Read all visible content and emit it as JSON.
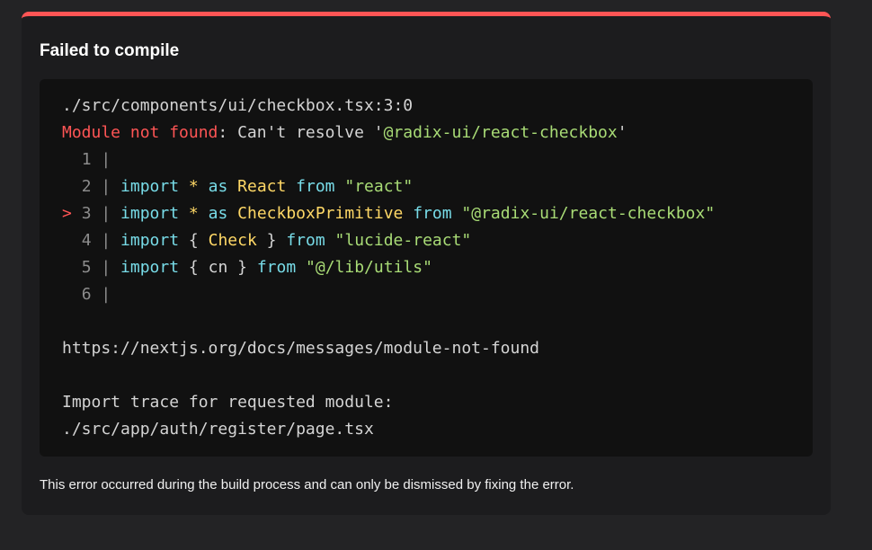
{
  "dialog": {
    "title": "Failed to compile",
    "footer": "This error occurred during the build process and can only be dismissed by fixing the error."
  },
  "error": {
    "location": "./src/components/ui/checkbox.tsx:3:0",
    "kind": "Module not found",
    "message_prefix": ": Can't resolve '",
    "module": "@radix-ui/react-checkbox",
    "message_suffix": "'",
    "doc_link": "https://nextjs.org/docs/messages/module-not-found",
    "trace_heading": "Import trace for requested module:",
    "trace_file": "./src/app/auth/register/page.tsx"
  },
  "code": {
    "highlighted_line": 3,
    "lines": [
      {
        "num": "1",
        "marker": " "
      },
      {
        "num": "2",
        "marker": " ",
        "kw_import": "import",
        "star": "*",
        "kw_as": "as",
        "name": "React",
        "kw_from": "from",
        "source": "\"react\""
      },
      {
        "num": "3",
        "marker": ">",
        "kw_import": "import",
        "star": "*",
        "kw_as": "as",
        "name": "CheckboxPrimitive",
        "kw_from": "from",
        "source": "\"@radix-ui/react-checkbox\""
      },
      {
        "num": "4",
        "marker": " ",
        "kw_import": "import",
        "open": "{",
        "name": "Check",
        "close": "}",
        "kw_from": "from",
        "source": "\"lucide-react\""
      },
      {
        "num": "5",
        "marker": " ",
        "kw_import": "import",
        "open": "{",
        "name": "cn",
        "close": "}",
        "kw_from": "from",
        "source": "\"@/lib/utils\""
      },
      {
        "num": "6",
        "marker": " "
      }
    ]
  },
  "colors": {
    "accent": "#ff5555",
    "string": "#a9dc76",
    "keyword": "#78dce8",
    "identifier": "#ffd866"
  }
}
